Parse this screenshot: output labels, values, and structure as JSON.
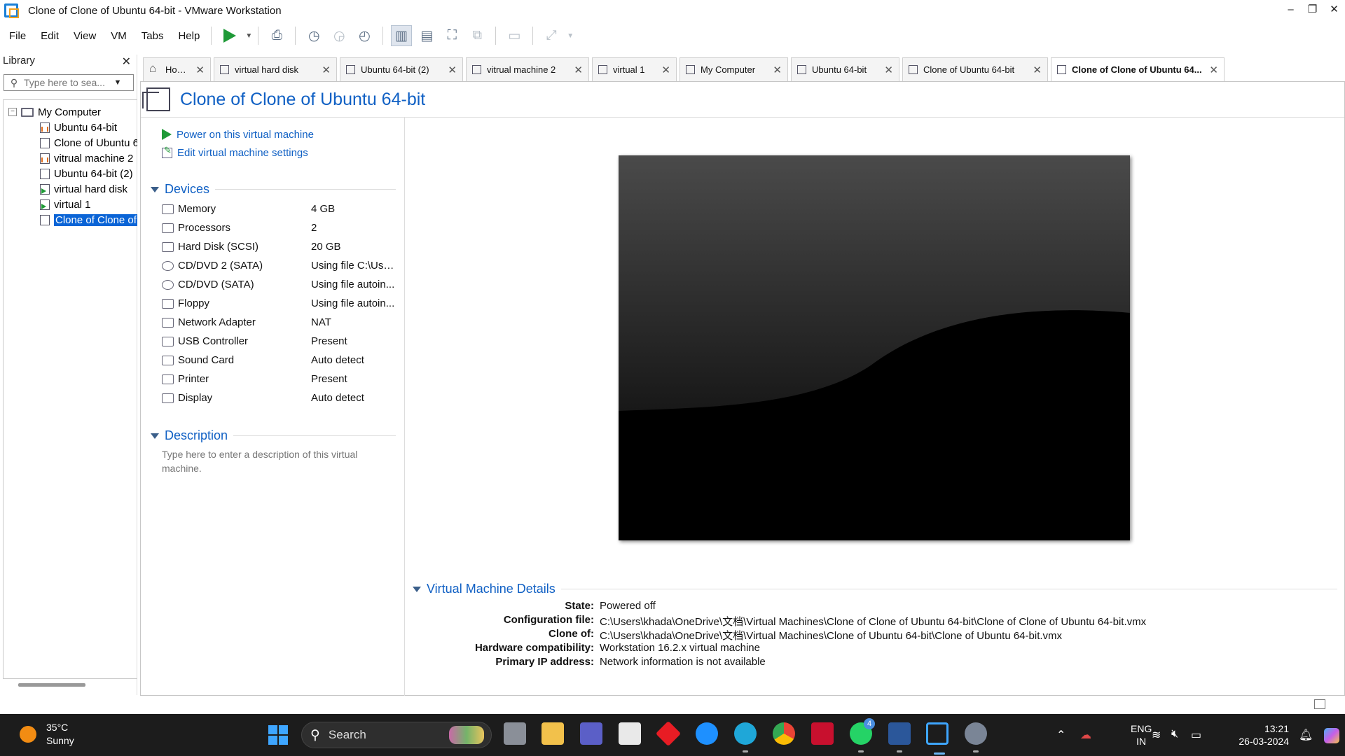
{
  "window": {
    "title": "Clone of Clone of Ubuntu 64-bit - VMware Workstation",
    "minimize": "–",
    "restore": "❐",
    "close": "✕"
  },
  "menu": [
    "File",
    "Edit",
    "View",
    "VM",
    "Tabs",
    "Help"
  ],
  "library": {
    "title": "Library",
    "close": "✕",
    "search_placeholder": "Type here to sea...",
    "root": "My Computer",
    "items": [
      {
        "label": "Ubuntu 64-bit",
        "state": "paused"
      },
      {
        "label": "Clone of Ubuntu 6",
        "state": "off"
      },
      {
        "label": "vitrual machine 2",
        "state": "paused"
      },
      {
        "label": "Ubuntu 64-bit (2)",
        "state": "off"
      },
      {
        "label": "virtual hard disk",
        "state": "running"
      },
      {
        "label": "virtual 1",
        "state": "running"
      },
      {
        "label": "Clone of Clone of",
        "state": "off",
        "selected": true
      }
    ]
  },
  "tabs": [
    {
      "label": "Home",
      "icon": "home-icon"
    },
    {
      "label": "virtual hard disk",
      "icon": "vm-running-icon"
    },
    {
      "label": "Ubuntu 64-bit (2)",
      "icon": "vm-icon"
    },
    {
      "label": "vitrual machine 2",
      "icon": "vm-paused-icon"
    },
    {
      "label": "virtual 1",
      "icon": "vm-running-icon"
    },
    {
      "label": "My Computer",
      "icon": "computer-icon"
    },
    {
      "label": "Ubuntu 64-bit",
      "icon": "vm-paused-icon"
    },
    {
      "label": "Clone of Ubuntu 64-bit",
      "icon": "vm-icon"
    },
    {
      "label": "Clone of Clone of Ubuntu 64...",
      "icon": "vm-icon",
      "active": true
    }
  ],
  "vm": {
    "title": "Clone of Clone of Ubuntu 64-bit",
    "power_on": "Power on this virtual machine",
    "edit_settings": "Edit virtual machine settings",
    "devices_title": "Devices",
    "devices": [
      {
        "name": "Memory",
        "value": "4 GB",
        "icon": "memory-icon"
      },
      {
        "name": "Processors",
        "value": "2",
        "icon": "processor-icon"
      },
      {
        "name": "Hard Disk (SCSI)",
        "value": "20 GB",
        "icon": "hard-disk-icon"
      },
      {
        "name": "CD/DVD 2 (SATA)",
        "value": "Using file C:\\Use...",
        "icon": "cd-dvd-icon"
      },
      {
        "name": "CD/DVD (SATA)",
        "value": "Using file autoin...",
        "icon": "cd-dvd-icon"
      },
      {
        "name": "Floppy",
        "value": "Using file autoin...",
        "icon": "floppy-icon"
      },
      {
        "name": "Network Adapter",
        "value": "NAT",
        "icon": "network-icon"
      },
      {
        "name": "USB Controller",
        "value": "Present",
        "icon": "usb-icon"
      },
      {
        "name": "Sound Card",
        "value": "Auto detect",
        "icon": "speaker-icon"
      },
      {
        "name": "Printer",
        "value": "Present",
        "icon": "printer-icon"
      },
      {
        "name": "Display",
        "value": "Auto detect",
        "icon": "display-icon"
      }
    ],
    "description_title": "Description",
    "description_placeholder": "Type here to enter a description of this virtual machine.",
    "details_title": "Virtual Machine Details",
    "details": [
      {
        "key": "State:",
        "value": "Powered off"
      },
      {
        "key": "Configuration file:",
        "value": "C:\\Users\\khada\\OneDrive\\文档\\Virtual Machines\\Clone of Clone of Ubuntu 64-bit\\Clone of Clone of Ubuntu 64-bit.vmx"
      },
      {
        "key": "Clone of:",
        "value": "C:\\Users\\khada\\OneDrive\\文档\\Virtual Machines\\Clone of Ubuntu 64-bit\\Clone of Ubuntu 64-bit.vmx"
      },
      {
        "key": "Hardware compatibility:",
        "value": "Workstation 16.2.x virtual machine"
      },
      {
        "key": "Primary IP address:",
        "value": "Network information is not available"
      }
    ]
  },
  "taskbar": {
    "weather_temp": "35°C",
    "weather_desc": "Sunny",
    "search": "Search",
    "whatsapp_badge": "4",
    "lang1": "ENG",
    "lang2": "IN",
    "time": "13:21",
    "date": "26-03-2024",
    "colors": {
      "accent": "#1060c4",
      "play": "#1f9a37",
      "taskbar": "#1c1c1c"
    }
  }
}
